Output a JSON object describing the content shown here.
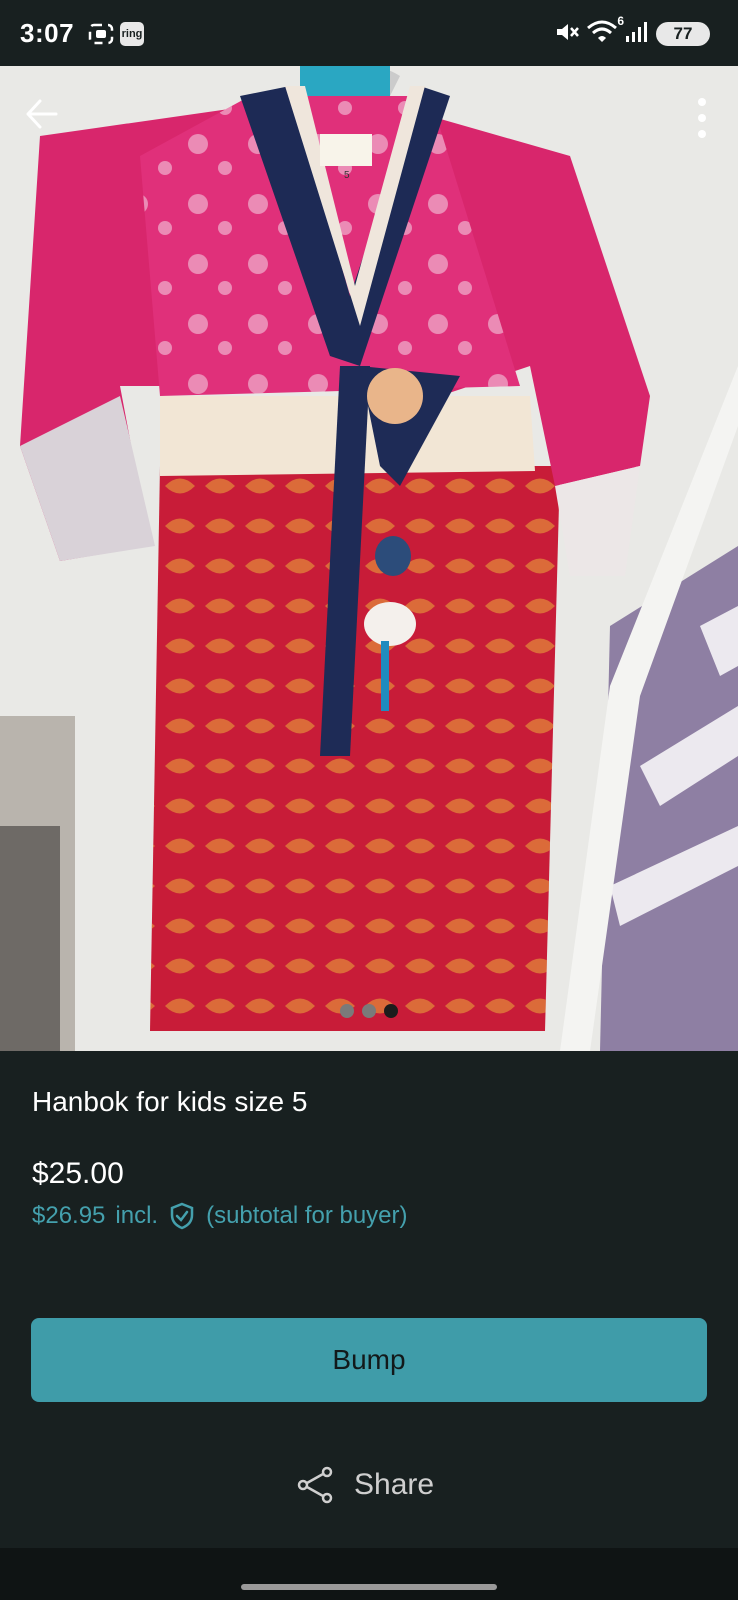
{
  "status_bar": {
    "time": "3:07",
    "ring_label": "ring",
    "battery": "77",
    "network_badge": "6"
  },
  "listing": {
    "title": "Hanbok for kids size 5",
    "price": "$25.00",
    "buyer_price": "$26.95",
    "buyer_incl": "incl.",
    "buyer_note": "(subtotal for buyer)",
    "image_count": 3,
    "active_image_index": 3,
    "garment_label": "5"
  },
  "actions": {
    "bump_label": "Bump",
    "share_label": "Share"
  },
  "colors": {
    "background": "#182020",
    "accent": "#3f9ca9",
    "accent_text": "#44a0ad"
  }
}
